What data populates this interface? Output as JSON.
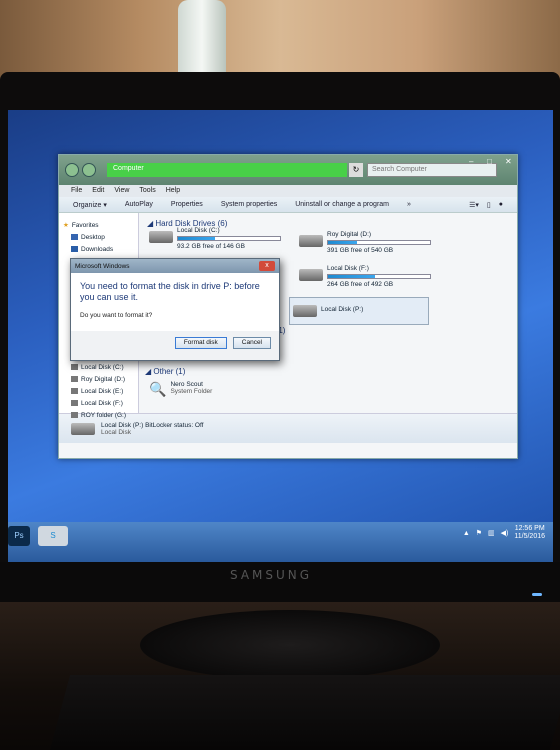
{
  "explorer": {
    "address": "Computer",
    "search_placeholder": "Search Computer",
    "menu": [
      "File",
      "Edit",
      "View",
      "Tools",
      "Help"
    ],
    "toolbar": [
      "Organize ▾",
      "AutoPlay",
      "Properties",
      "System properties",
      "Uninstall or change a program",
      "»"
    ],
    "nav": {
      "favorites": "Favorites",
      "items": [
        "Desktop",
        "Downloads"
      ],
      "drives": [
        "Local Disk (C:)",
        "Roy Digital (D:)",
        "Local Disk (E:)",
        "Local Disk (F:)",
        "ROY folder (G:)"
      ]
    },
    "groups": {
      "hdd": "Hard Disk Drives (6)",
      "removable_suffix": "e (1)",
      "other": "Other (1)"
    },
    "drives": {
      "c_name": "Local Disk (C:)",
      "c_free": "93.2 GB free of 146 GB",
      "c_fill": 0.36,
      "d_name": "Roy Digital (D:)",
      "d_free": "391 GB free of 540 GB",
      "d_fill": 0.28,
      "f_name": "Local Disk (F:)",
      "f_free": "264 GB free of 492 GB",
      "f_fill": 0.46,
      "p_name": "Local Disk (P:)"
    },
    "other_item": {
      "name": "Nero Scout",
      "type": "System Folder"
    },
    "status": {
      "name": "Local Disk (P:)",
      "bitlocker": "BitLocker status: Off",
      "type": "Local Disk"
    }
  },
  "dialog": {
    "title": "Microsoft Windows",
    "message": "You need to format the disk in drive P: before you can use it.",
    "question": "Do you want to format it?",
    "format_label": "Format disk",
    "cancel_label": "Cancel",
    "close_label": "x"
  },
  "taskbar": {
    "ps_label": "Ps",
    "skype_label": "S",
    "time": "12:56 PM",
    "date": "11/5/2016"
  },
  "monitor": {
    "brand": "SAMSUNG"
  }
}
